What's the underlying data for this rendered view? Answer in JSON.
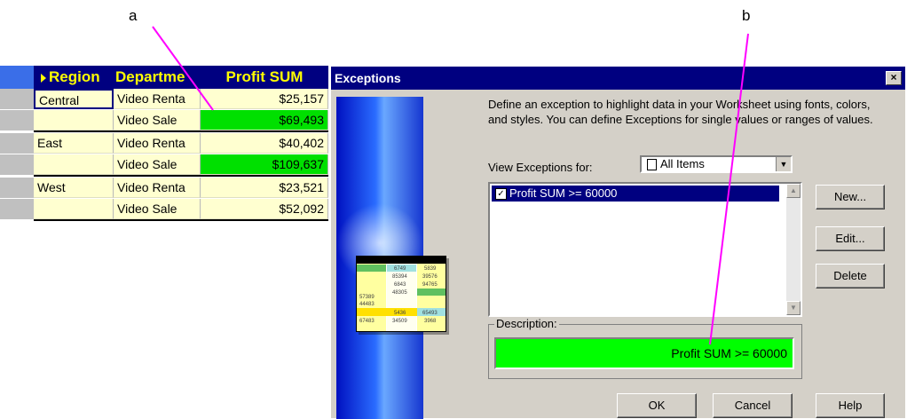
{
  "callouts": {
    "a": "a",
    "b": "b"
  },
  "colors": {
    "accent": "#000080",
    "highlight": "#00ff00",
    "header_text": "#ffff00",
    "cell_bg": "#ffffd0",
    "callout_line": "#ff00ff"
  },
  "worksheet": {
    "headers": {
      "region": "Region",
      "department": "Departme",
      "profit": "Profit SUM"
    },
    "rows": [
      {
        "region": "Central",
        "department": "Video Renta",
        "profit": "$25,157",
        "highlighted": false
      },
      {
        "region": "",
        "department": "Video Sale",
        "profit": "$69,493",
        "highlighted": true
      },
      {
        "region": "East",
        "department": "Video Renta",
        "profit": "$40,402",
        "highlighted": false
      },
      {
        "region": "",
        "department": "Video Sale",
        "profit": "$109,637",
        "highlighted": true
      },
      {
        "region": "West",
        "department": "Video Renta",
        "profit": "$23,521",
        "highlighted": false
      },
      {
        "region": "",
        "department": "Video Sale",
        "profit": "$52,092",
        "highlighted": false
      }
    ]
  },
  "dialog": {
    "title": "Exceptions",
    "close_label": "×",
    "description_line1": "Define an exception to highlight data in your Worksheet using fonts, colors,",
    "description_line2": "and styles. You can define Exceptions for single values or ranges of values.",
    "view_label": "View Exceptions for:",
    "view_value": "All Items",
    "exceptions": [
      {
        "label": "Profit SUM  >= 60000",
        "checked": true
      }
    ],
    "description_group_label": "Description:",
    "description_value": "Profit SUM  >= 60000",
    "buttons": {
      "new": "New...",
      "edit": "Edit...",
      "delete": "Delete",
      "ok": "OK",
      "cancel": "Cancel",
      "help": "Help"
    },
    "illustration": {
      "col1": [
        "",
        "",
        "",
        "57389",
        "44483",
        "",
        "67483"
      ],
      "col2": [
        "6749",
        "85394",
        "6843",
        "48305",
        "",
        "5436",
        "34509"
      ],
      "col3": [
        "5839",
        "39576",
        "94765",
        "",
        "",
        "65493",
        "3968"
      ]
    }
  }
}
